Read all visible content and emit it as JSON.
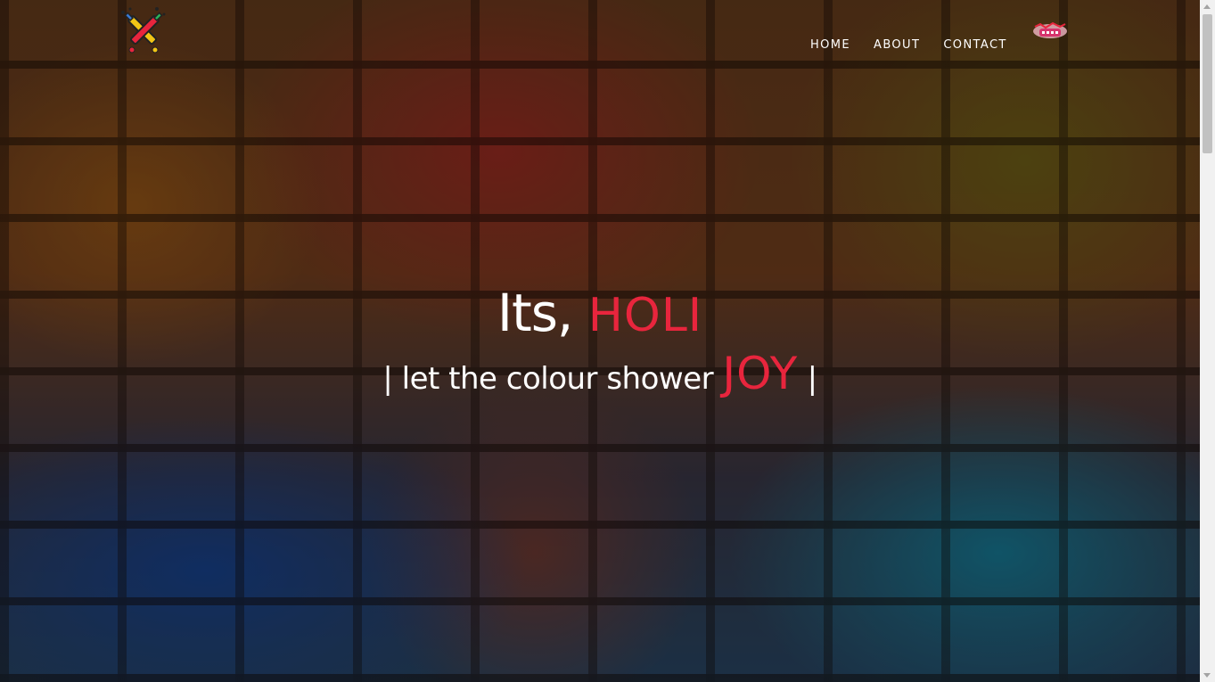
{
  "nav": {
    "links": [
      "HOME",
      "ABOUT",
      "CONTACT"
    ],
    "badge_icon": "holi-badge-icon",
    "brand_icon": "color-pichkari-logo-icon"
  },
  "hero": {
    "headline_prefix": "Its,",
    "headline_accent": "HOLI",
    "tagline_prefix": "| let the colour shower",
    "tagline_accent": "JOY",
    "tagline_suffix": "|"
  },
  "colors": {
    "accent": "#e8253d",
    "text": "#ffffff"
  }
}
